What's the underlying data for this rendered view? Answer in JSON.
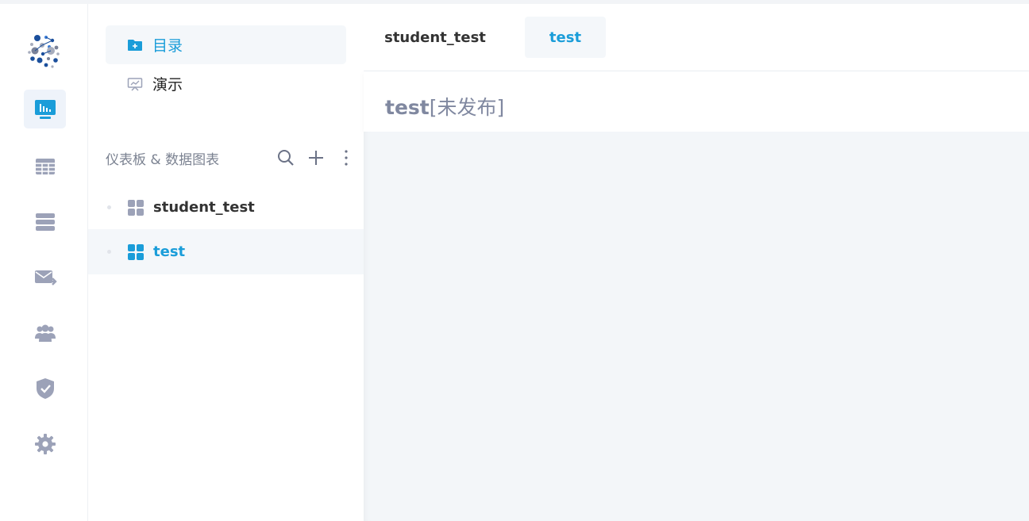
{
  "colors": {
    "accent": "#1a9dd9",
    "icon": "#9ca2b8",
    "active_bg": "#eef3fa"
  },
  "rail": {
    "logo": "datart-logo",
    "items": [
      {
        "icon": "dashboard-monitor-icon",
        "active": true
      },
      {
        "icon": "table-grid-icon",
        "active": false
      },
      {
        "icon": "stack-list-icon",
        "active": false
      },
      {
        "icon": "mail-send-icon",
        "active": false
      },
      {
        "icon": "users-group-icon",
        "active": false
      },
      {
        "icon": "shield-check-icon",
        "active": false
      },
      {
        "icon": "gear-icon",
        "active": false
      }
    ]
  },
  "panel": {
    "nav": [
      {
        "label": "目录",
        "icon": "folder-icon",
        "active": true
      },
      {
        "label": "演示",
        "icon": "presentation-icon",
        "active": false
      }
    ],
    "section_title": "仪表板 & 数据图表",
    "tools": [
      "search-icon",
      "plus-icon",
      "more-vertical-icon"
    ],
    "tree": [
      {
        "name": "student_test",
        "active": false
      },
      {
        "name": "test",
        "active": true
      }
    ]
  },
  "main": {
    "tabs": [
      {
        "label": "student_test",
        "active": false
      },
      {
        "label": "test",
        "active": true
      }
    ],
    "title": "test",
    "status": "[未发布]"
  }
}
